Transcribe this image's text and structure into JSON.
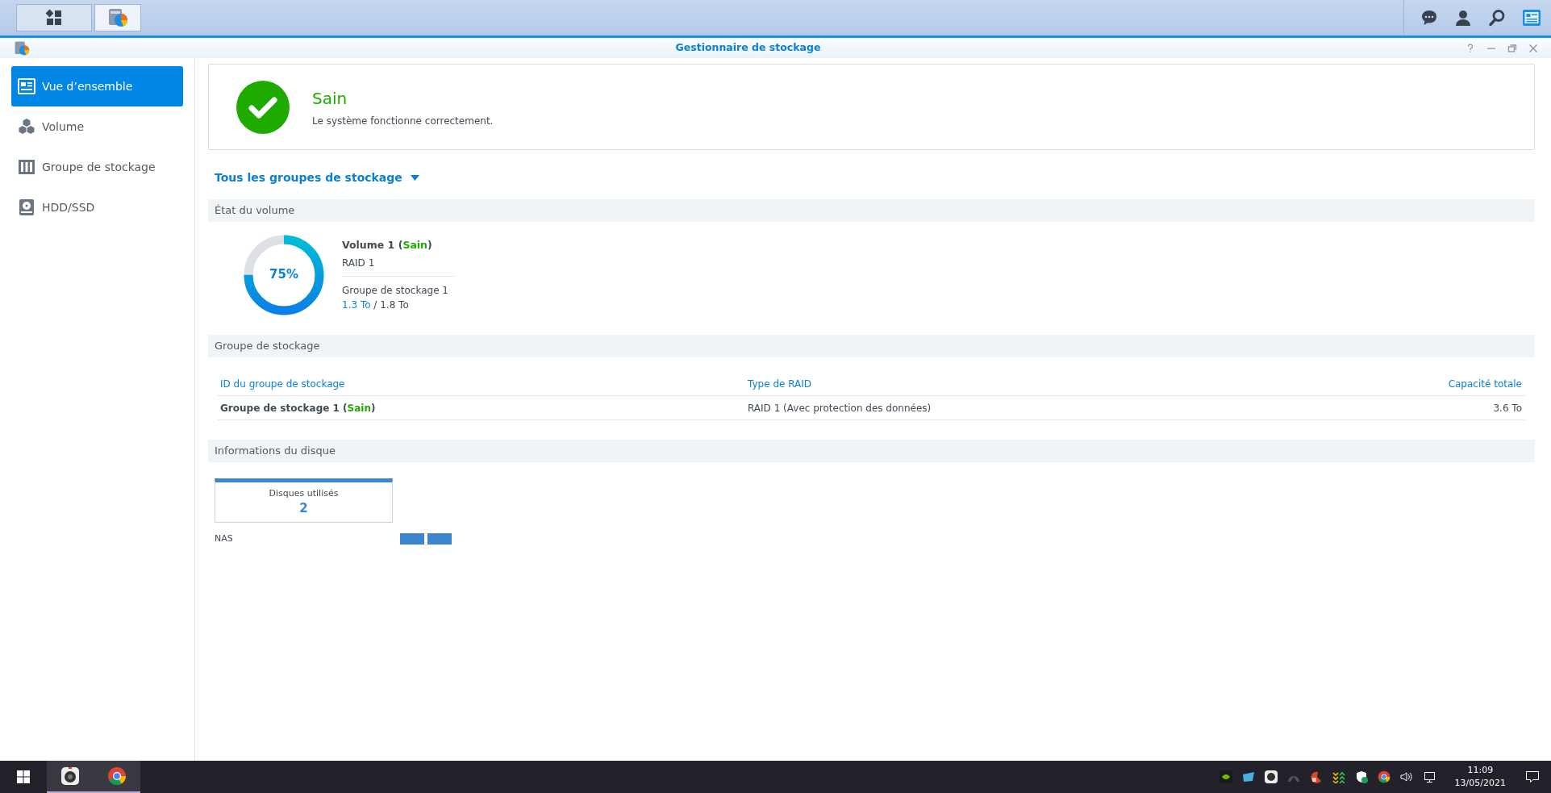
{
  "window": {
    "title": "Gestionnaire de stockage"
  },
  "sidebar": {
    "items": [
      {
        "label": "Vue d’ensemble",
        "kind": "overview",
        "selected": true
      },
      {
        "label": "Volume",
        "kind": "volume",
        "selected": false
      },
      {
        "label": "Groupe de stockage",
        "kind": "pool",
        "selected": false
      },
      {
        "label": "HDD/SSD",
        "kind": "disk",
        "selected": false
      }
    ]
  },
  "health": {
    "status": "Sain",
    "message": "Le système fonctionne correctement."
  },
  "filter": {
    "label": "Tous les groupes de stockage"
  },
  "volume_section": {
    "title": "État du volume",
    "volumes": [
      {
        "name": "Volume 1 (",
        "status": "Sain",
        "closing": ")",
        "raid": "RAID 1",
        "pool": "Groupe de stockage 1",
        "used": "1.3 To",
        "separator": "/",
        "total": "1.8 To",
        "percent": "75%",
        "level": 0.75
      }
    ]
  },
  "pool_section": {
    "title": "Groupe de stockage",
    "columns": [
      "ID du groupe de stockage",
      "Type de RAID",
      "Capacité totale"
    ],
    "rows": [
      {
        "name": "Groupe de stockage 1 (",
        "status": "Sain",
        "closing": ")",
        "raid": "RAID 1 (Avec protection des données)",
        "capacity": "3.6 To"
      }
    ]
  },
  "disk_section": {
    "title": "Informations du disque",
    "summary": {
      "label": "Disques utilisés",
      "value": "2"
    },
    "devices": [
      {
        "name": "NAS",
        "slots": [
          {
            "used": true
          },
          {
            "used": true
          }
        ]
      }
    ]
  },
  "taskbar": {
    "time": "11:09",
    "date": "13/05/2021"
  }
}
